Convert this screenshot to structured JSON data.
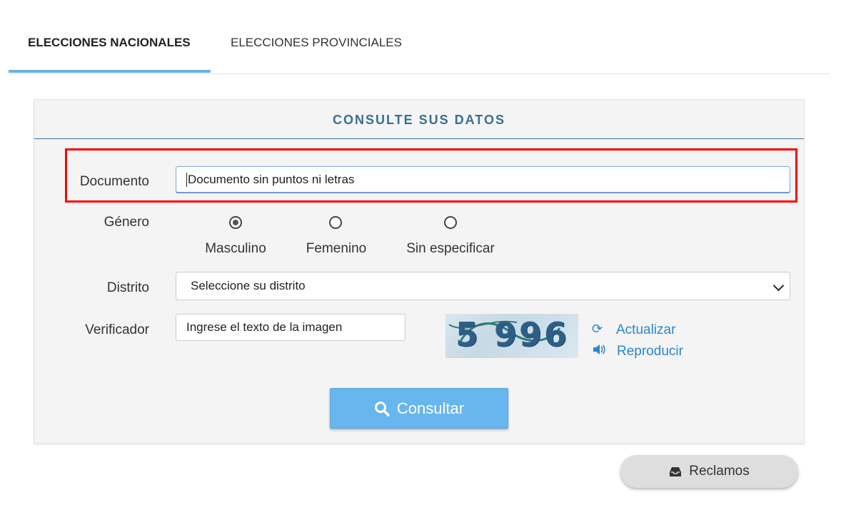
{
  "tabs": [
    {
      "label": "ELECCIONES NACIONALES",
      "active": true
    },
    {
      "label": "ELECCIONES PROVINCIALES",
      "active": false
    }
  ],
  "panel": {
    "title": "CONSULTE SUS DATOS"
  },
  "documento": {
    "label": "Documento",
    "placeholder": "Documento sin puntos ni letras"
  },
  "genero": {
    "label": "Género",
    "options": [
      {
        "label": "Masculino",
        "checked": true
      },
      {
        "label": "Femenino",
        "checked": false
      },
      {
        "label": "Sin especificar",
        "checked": false
      }
    ]
  },
  "distrito": {
    "label": "Distrito",
    "selected": "Seleccione su distrito"
  },
  "verificador": {
    "label": "Verificador",
    "placeholder": "Ingrese el texto de la imagen",
    "captcha_text": "5 996",
    "refresh_label": "Actualizar",
    "audio_label": "Reproducir"
  },
  "consultar_label": "Consultar",
  "reclamos_label": "Reclamos",
  "colors": {
    "accent": "#67b6ee",
    "title": "#3a6f8f",
    "link": "#2a86cf",
    "highlight": "#ff0000"
  }
}
